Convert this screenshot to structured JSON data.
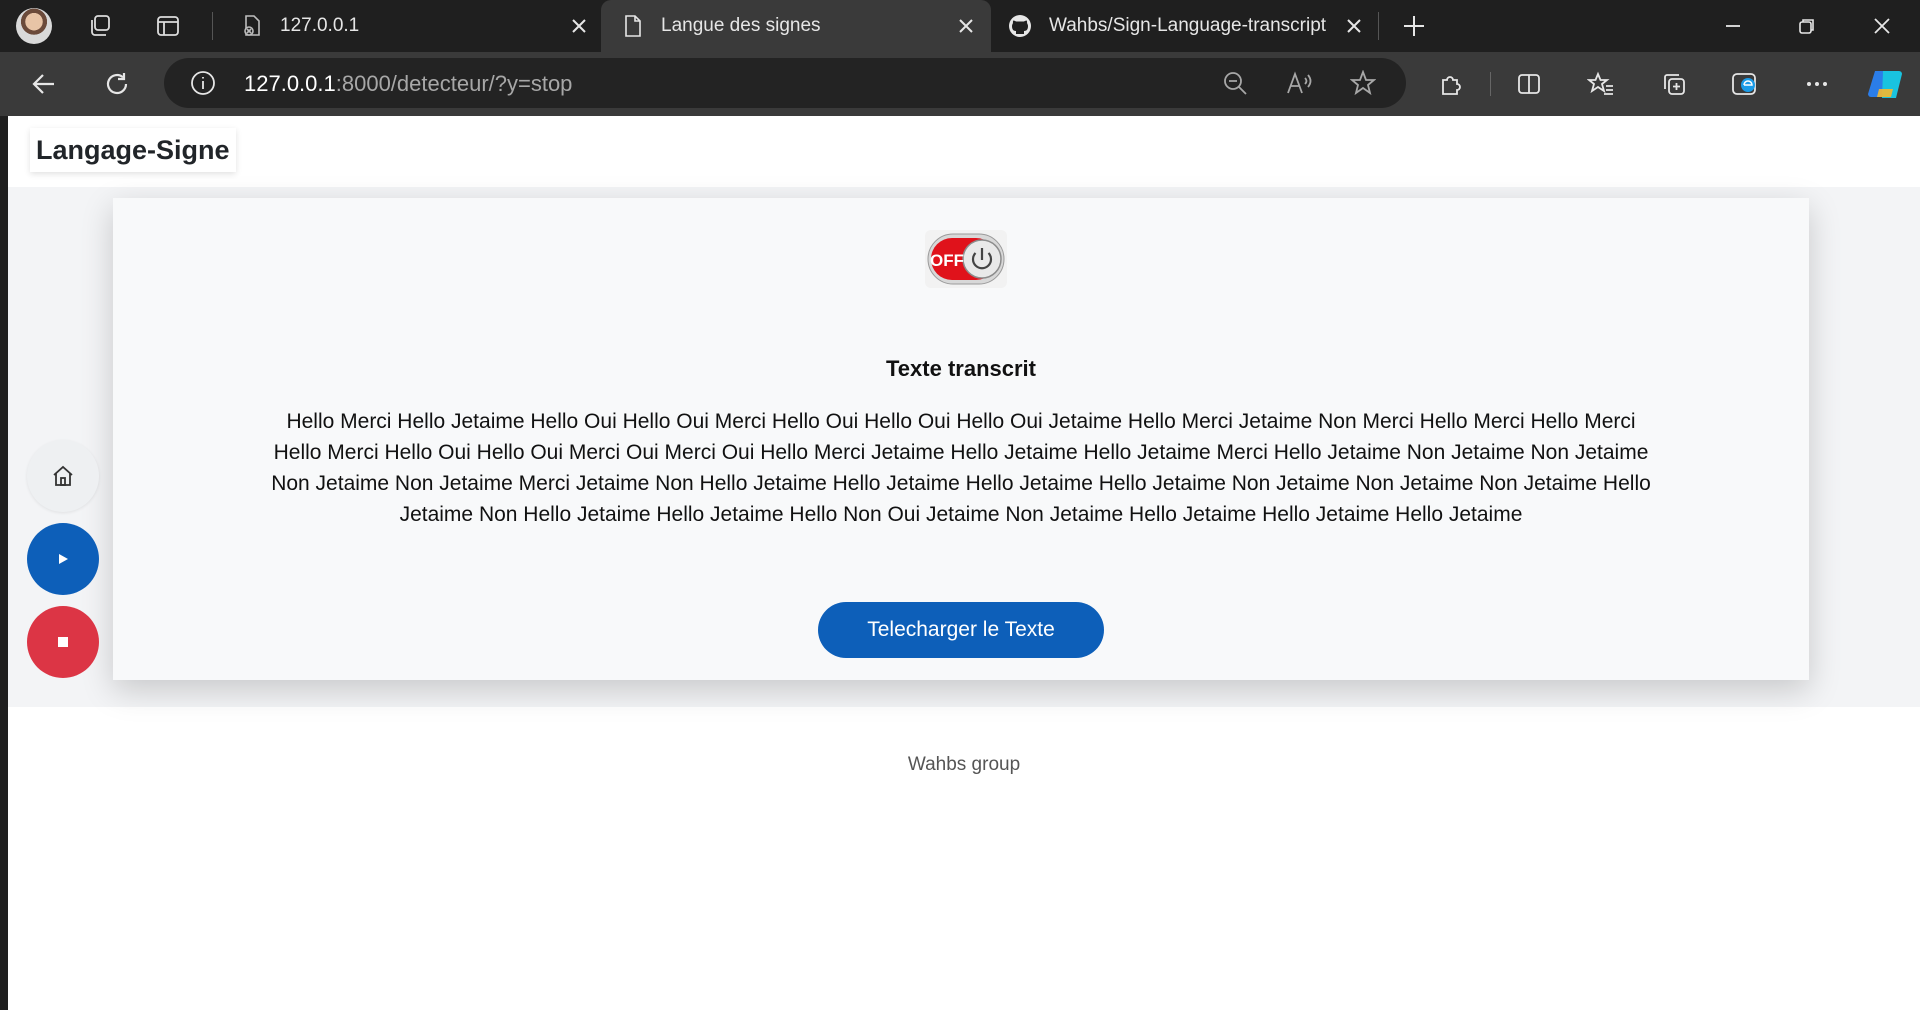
{
  "browser": {
    "tabs": [
      {
        "title": "127.0.0.1",
        "favicon": "blocked-page-icon"
      },
      {
        "title": "Langue des signes",
        "favicon": "page-icon",
        "active": true
      },
      {
        "title": "Wahbs/Sign-Language-transcript",
        "favicon": "github-icon"
      }
    ],
    "url": {
      "host": "127.0.0.1",
      "rest": ":8000/detecteur/?y=stop"
    }
  },
  "page": {
    "brand": "Langage-Signe",
    "switch_label": "OFF",
    "transcript_title": "Texte transcrit",
    "transcript_text": "Hello Merci Hello Jetaime Hello Oui Hello Oui Merci Hello Oui Hello Oui Hello Oui Jetaime Hello Merci Jetaime Non Merci Hello Merci Hello Merci Hello Merci Hello Oui Hello Oui Merci Oui Merci Oui Hello Merci Jetaime Hello Jetaime Hello Jetaime Merci Hello Jetaime Non Jetaime Non Jetaime Non Jetaime Non Jetaime Merci Jetaime Non Hello Jetaime Hello Jetaime Hello Jetaime Hello Jetaime Non Jetaime Non Jetaime Non Jetaime Hello Jetaime Non Hello Jetaime Hello Jetaime Hello Non Oui Jetaime Non Jetaime Hello Jetaime Hello Jetaime Hello Jetaime",
    "download_button": "Telecharger le Texte",
    "footer": "Wahbs group"
  },
  "colors": {
    "primary": "#0d5fb9",
    "danger": "#dc3545",
    "switch_red": "#e0121b"
  }
}
